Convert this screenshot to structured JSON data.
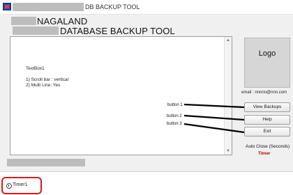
{
  "window": {
    "title": "DB BACKUP TOOL"
  },
  "header": {
    "line1": "NAGALAND",
    "line2": "DATABASE BACKUP TOOL"
  },
  "textbox": {
    "name": "TextBox1",
    "note1": "1) Scroll bar : vertical",
    "note2": "2) Multi Line: Yes"
  },
  "logo": {
    "label": "Logo"
  },
  "email": "email : nnnnn@nnn.com",
  "buttons": {
    "view_backups": "View Backups",
    "help": "Help",
    "exit": "Exit"
  },
  "callouts": {
    "button1": "button 1",
    "button2": "button 2",
    "button3": "button 3"
  },
  "autoclose": {
    "label": "Auto Close (Seconds)",
    "timer": "Timer"
  },
  "component_tray": {
    "timer_name": "Timer1"
  },
  "colors": {
    "timer_text": "#c00000",
    "tray_highlight": "#e01818"
  }
}
